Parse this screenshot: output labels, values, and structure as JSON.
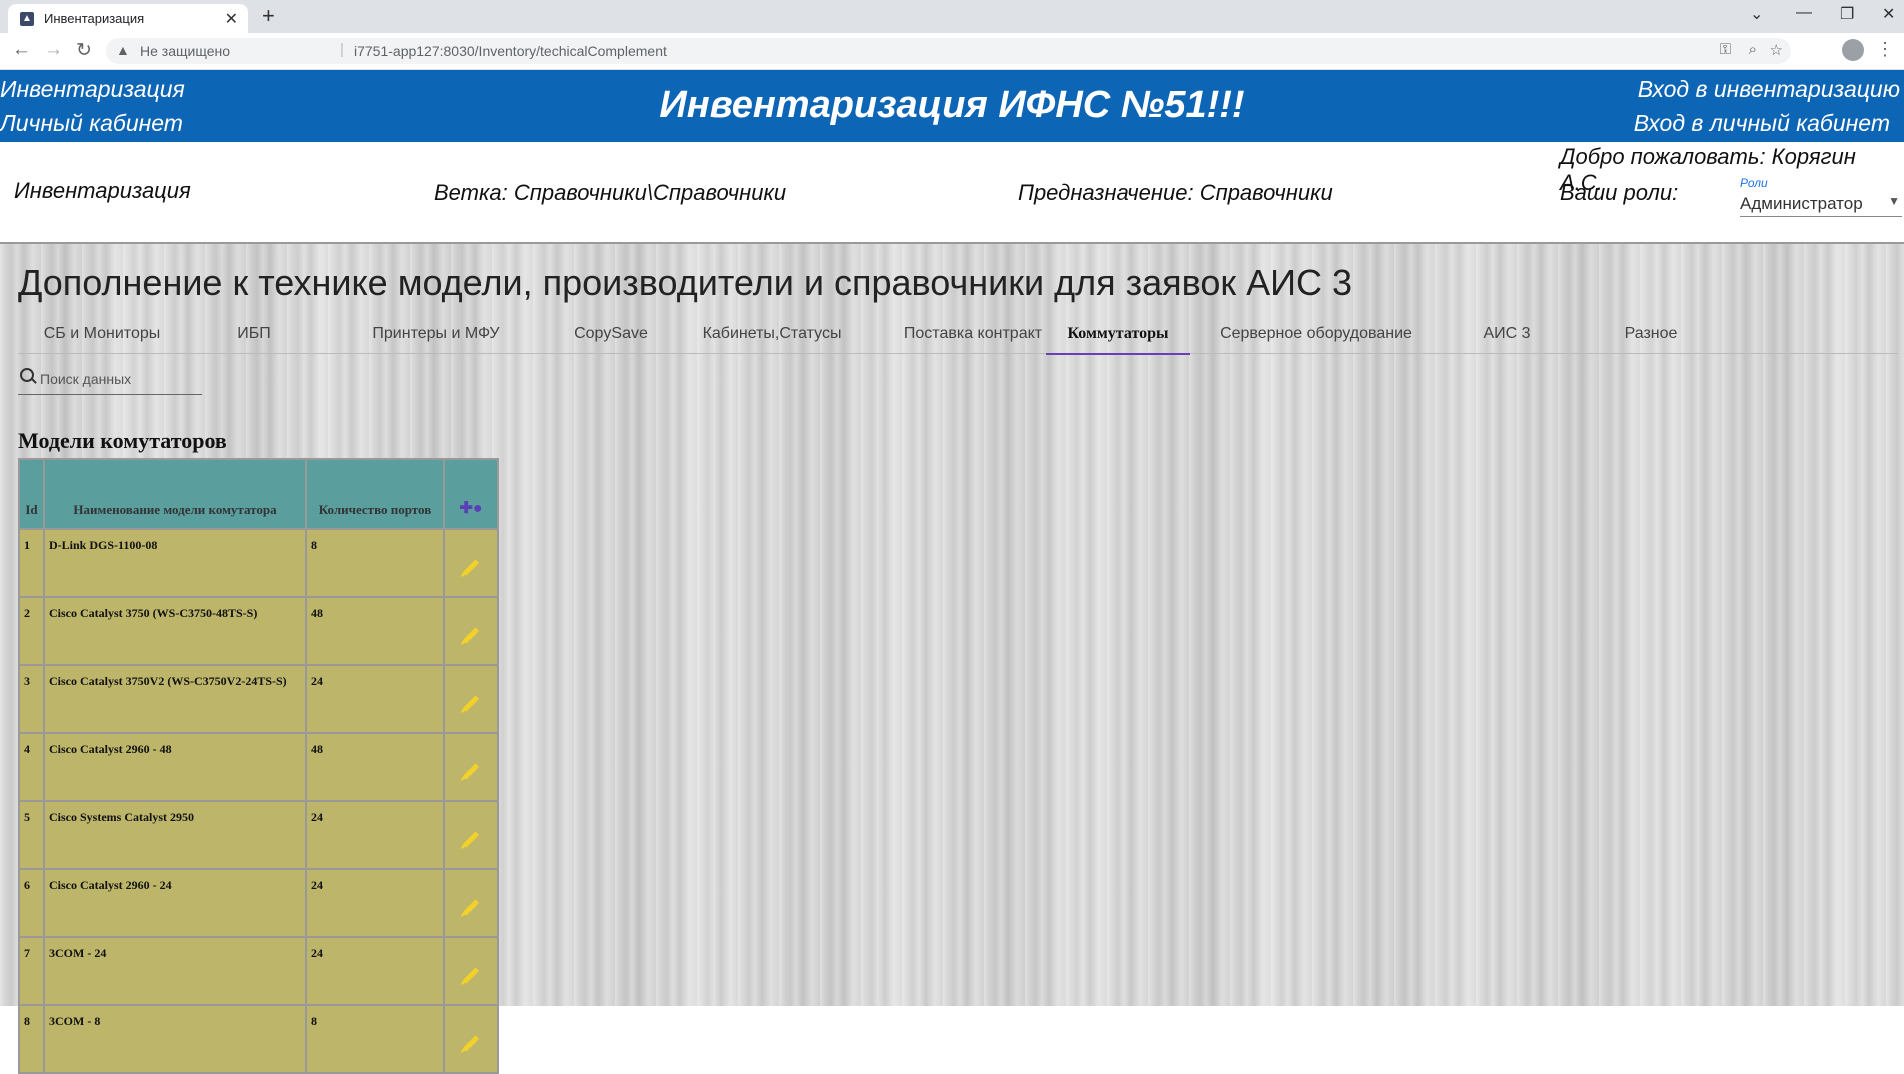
{
  "browser": {
    "tab_title": "Инвентаризация",
    "not_secure": "Не защищено",
    "url": "i7751-app127:8030/Inventory/techicalComplement"
  },
  "header": {
    "left_link_1": "Инвентаризация",
    "left_link_2": "Личный кабинет",
    "title": "Инвентаризация ИФНС №51!!!",
    "right_link_1": "Вход в инвентаризацию",
    "right_link_2": "Вход в личный кабинет"
  },
  "info": {
    "section": "Инвентаризация",
    "branch": "Ветка: Справочники\\Справочники",
    "purpose": "Предназначение: Справочники",
    "welcome": "Добро пожаловать: Корягин А.С.",
    "roles_label": "Ваши роли:",
    "roles_small": "Роли",
    "roles_value": "Администратор"
  },
  "page": {
    "heading": "Дополнение к технике модели, производители и справочники для заявок АИС 3",
    "tabs": [
      "СБ и Мониторы",
      "ИБП",
      "Принтеры и МФУ",
      "CopySave",
      "Кабинеты,Статусы",
      "Поставка контракт",
      "Коммутаторы",
      "Серверное оборудование",
      "АИС 3",
      "Разное"
    ],
    "active_tab": "Коммутаторы",
    "search_placeholder": "Поиск данных",
    "table_title": "Модели комутаторов"
  },
  "table": {
    "headers": {
      "id": "Id",
      "name": "Наименование модели комутатора",
      "ports": "Количество портов"
    },
    "rows": [
      {
        "id": "1",
        "name": "D-Link DGS-1100-08",
        "ports": "8"
      },
      {
        "id": "2",
        "name": "Cisco Catalyst 3750 (WS-C3750-48TS-S)",
        "ports": "48"
      },
      {
        "id": "3",
        "name": "Cisco Catalyst 3750V2 (WS-C3750V2-24TS-S)",
        "ports": "24"
      },
      {
        "id": "4",
        "name": "Cisco Catalyst 2960 - 48",
        "ports": "48"
      },
      {
        "id": "5",
        "name": "Cisco Systems Catalyst 2950",
        "ports": "24"
      },
      {
        "id": "6",
        "name": "Cisco Catalyst 2960 - 24",
        "ports": "24"
      },
      {
        "id": "7",
        "name": "3COM - 24",
        "ports": "24"
      },
      {
        "id": "8",
        "name": "3COM - 8",
        "ports": "8"
      }
    ]
  },
  "colors": {
    "header_bg": "#0d65b5",
    "table_header": "#5a9e9e",
    "table_row": "#bcb56a",
    "active_tab_underline": "#6a3fb5",
    "edit_icon": "#f1d12a"
  }
}
